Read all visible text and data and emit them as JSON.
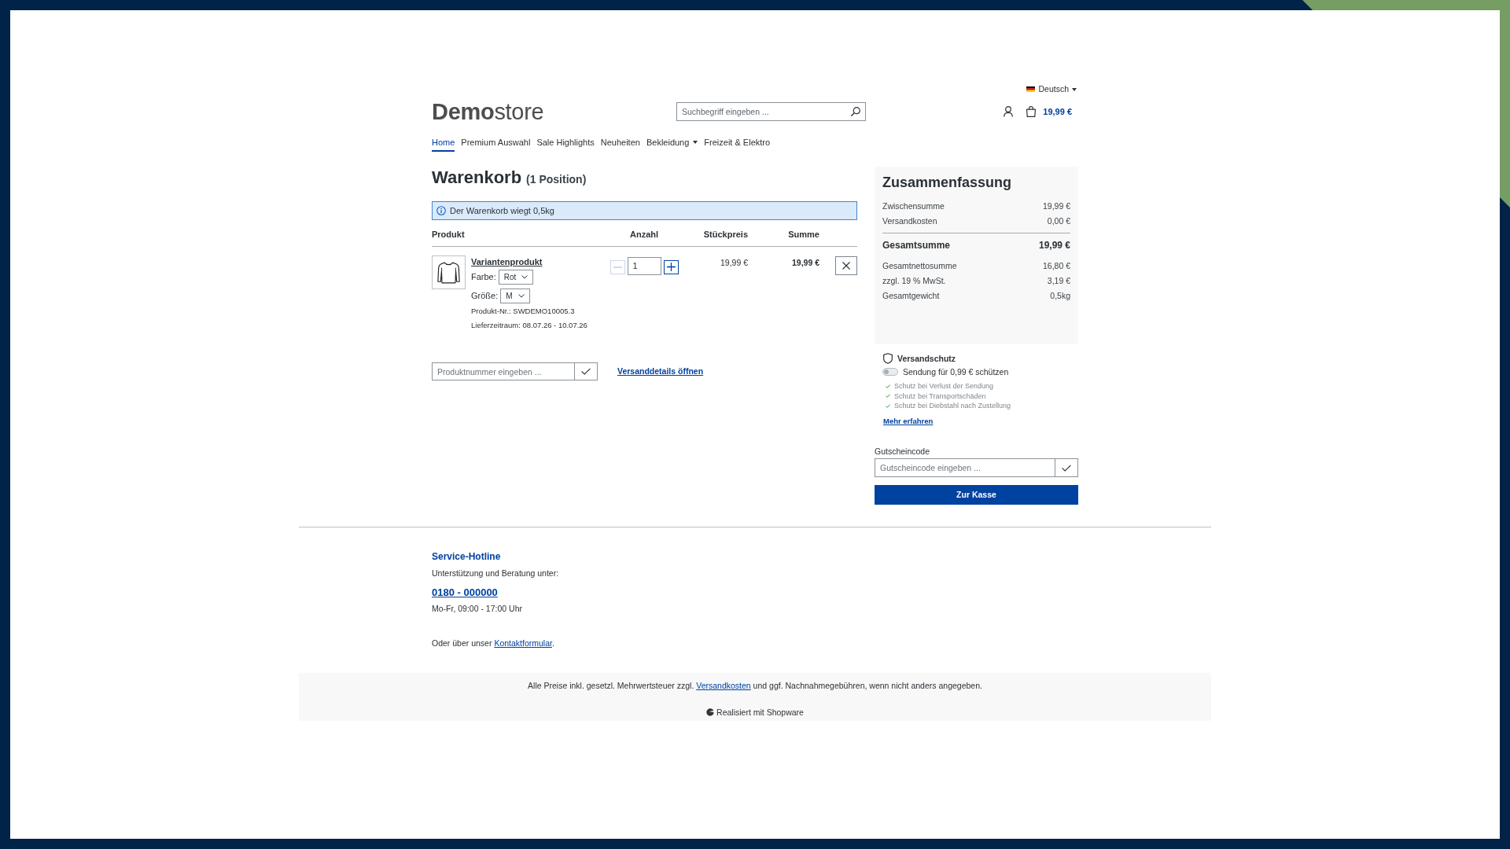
{
  "header": {
    "language": {
      "label": "Deutsch"
    },
    "logo": "**Demo**store",
    "search": {
      "placeholder": "Suchbegriff eingeben ..."
    },
    "cart_total": "19,99 €"
  },
  "nav": [
    {
      "label": "Home",
      "selected": true,
      "dropdown": false
    },
    {
      "label": "Premium Auswahl",
      "selected": false,
      "dropdown": false
    },
    {
      "label": "Sale Highlights",
      "selected": false,
      "dropdown": false
    },
    {
      "label": "Neuheiten",
      "selected": false,
      "dropdown": false
    },
    {
      "label": "Bekleidung",
      "selected": false,
      "dropdown": true
    },
    {
      "label": "Freizeit & Elektro",
      "selected": false,
      "dropdown": false
    }
  ],
  "cart": {
    "title": "Warenkorb",
    "count": "(1 Position)",
    "alert": "Der Warenkorb wiegt 0,5kg",
    "columns": [
      "Produkt",
      "Anzahl",
      "Stückpreis",
      "Summe"
    ],
    "items": [
      {
        "name": "Variantenprodukt",
        "options": [
          {
            "label": "Farbe:",
            "value": "Rot"
          },
          {
            "label": "Größe:",
            "value": "M"
          }
        ],
        "product_number": "Produkt-Nr.: SWDEMO10005.3",
        "delivery": "Lieferzeitraum: 08.07.26 - 10.07.26",
        "quantity": "1",
        "decrease_disabled": true,
        "unit_price": "19,99 €",
        "total": "19,99 €"
      }
    ],
    "product_entry": {
      "placeholder": "Produktnummer eingeben ..."
    },
    "shipping_details_link": "Versanddetails öffnen"
  },
  "summary": {
    "title": "Zusammenfassung",
    "rows": [
      {
        "kind": "line",
        "label": "Zwischensumme",
        "value": "19,99 €"
      },
      {
        "kind": "line",
        "label": "Versandkosten",
        "value": "0,00 €"
      },
      {
        "kind": "total",
        "label": "Gesamtsumme",
        "value": "19,99 €"
      },
      {
        "kind": "line",
        "label": "Gesamtnettosumme",
        "value": "16,80 €"
      },
      {
        "kind": "line",
        "label": "zzgl. 19 % MwSt.",
        "value": "3,19 €"
      },
      {
        "kind": "line",
        "label": "Gesamtgewicht",
        "value": "0,5kg"
      }
    ]
  },
  "shipping_protection": {
    "title": "Versandschutz",
    "toggle": {
      "label": "Sendung für 0,99 € schützen",
      "on": false
    },
    "benefits": [
      "Schutz bei Verlust der Sendung",
      "Schutz bei Transportschäden",
      "Schutz bei Diebstahl nach Zustellung"
    ],
    "link": "Mehr erfahren"
  },
  "voucher": {
    "label": "Gutscheincode",
    "placeholder": "Gutscheincode eingeben ..."
  },
  "checkout_button": "Zur Kasse",
  "footer": {
    "hotline": {
      "title": "Service-Hotline",
      "text": "Unterstützung und Beratung unter:",
      "phone": "0180 - 000000",
      "hours": "Mo-Fr, 09:00 - 17:00 Uhr"
    },
    "contact": {
      "before": "Oder über unser ",
      "link": "Kontaktformular",
      "after": "."
    },
    "legal": {
      "before": "Alle Preise inkl. gesetzl. Mehrwertsteuer zzgl. ",
      "link": "Versandkosten",
      "after": " und ggf. Nachnahmegebühren, wenn nicht anders angegeben."
    },
    "powered_by": "Realisiert mit Shopware"
  }
}
